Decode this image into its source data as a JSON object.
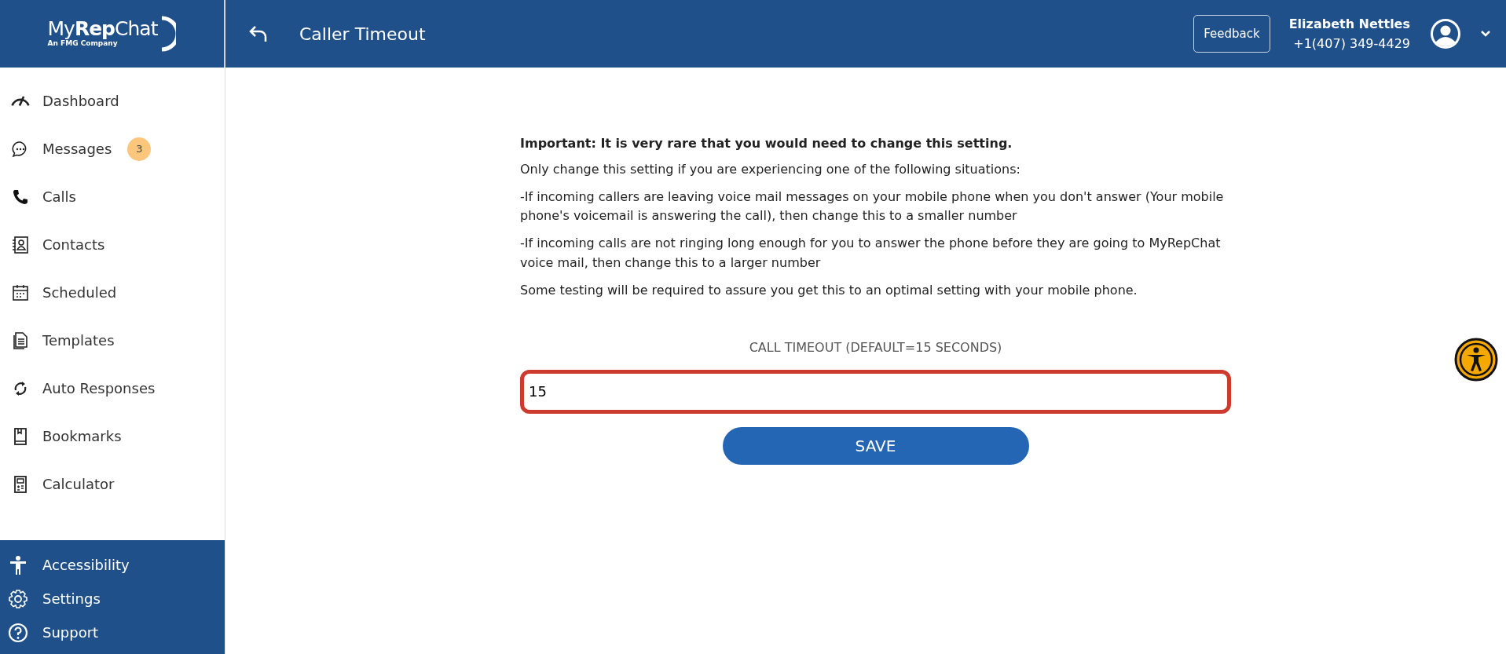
{
  "logo": {
    "name": "My**Rep**Chat",
    "tagline": "An FMG Company"
  },
  "header": {
    "title": "Caller Timeout",
    "feedback": "Feedback",
    "user_name": "Elizabeth Nettles",
    "user_phone": "+1(407) 349-4429"
  },
  "sidebar": {
    "items": [
      {
        "label": "Dashboard"
      },
      {
        "label": "Messages",
        "badge": "3"
      },
      {
        "label": "Calls"
      },
      {
        "label": "Contacts"
      },
      {
        "label": "Scheduled"
      },
      {
        "label": "Templates"
      },
      {
        "label": "Auto Responses"
      },
      {
        "label": "Bookmarks"
      },
      {
        "label": "Calculator"
      }
    ],
    "footer_items": [
      {
        "label": "Accessibility"
      },
      {
        "label": "Settings"
      },
      {
        "label": "Support"
      }
    ]
  },
  "content": {
    "heading": "Important: It is very rare that you would need to change this setting.",
    "paragraphs": [
      "Only change this setting if you are experiencing one of the following situations:",
      "-If incoming callers are leaving voice mail messages on your mobile phone when you don't answer (Your mobile phone's voicemail is answering the call), then change this to a smaller number",
      "-If incoming calls are not ringing long enough for you to answer the phone before they are going to MyRepChat voice mail, then change this to a larger number",
      "Some testing will be required to assure you get this to an optimal setting with your mobile phone."
    ],
    "field_label": "CALL TIMEOUT (DEFAULT=15 SECONDS)",
    "field_value": "15",
    "save": "SAVE"
  }
}
